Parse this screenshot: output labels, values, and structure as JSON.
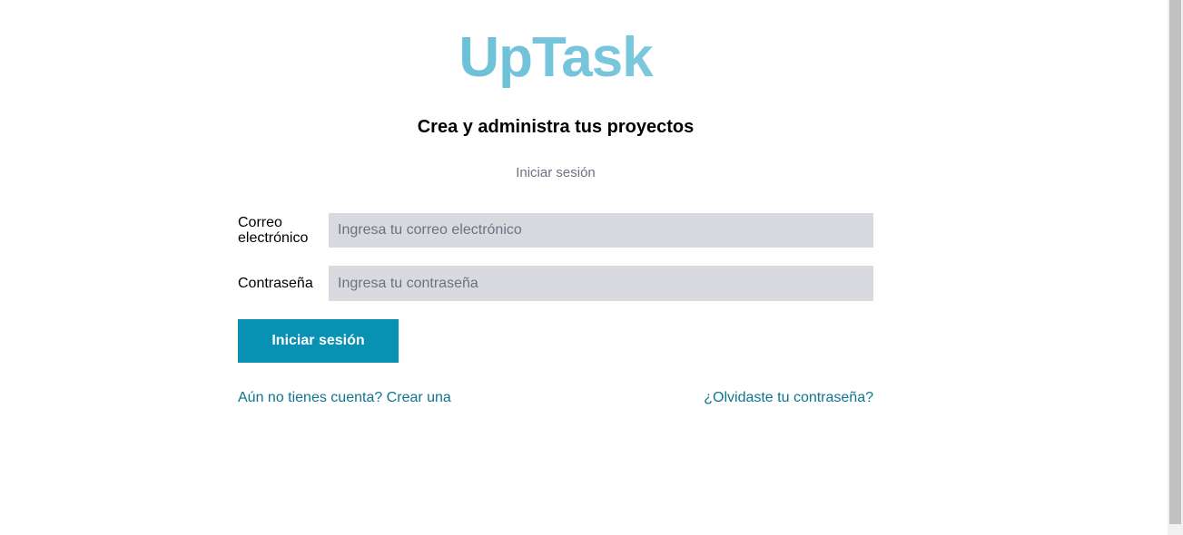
{
  "brand": {
    "logo_text": "UpTask",
    "tagline": "Crea y administra tus proyectos"
  },
  "login": {
    "subtitle": "Iniciar sesión",
    "email": {
      "label": "Correo electrónico",
      "placeholder": "Ingresa tu correo electrónico",
      "value": ""
    },
    "password": {
      "label": "Contraseña",
      "placeholder": "Ingresa tu contraseña",
      "value": ""
    },
    "submit_label": "Iniciar sesión"
  },
  "links": {
    "create_account": "Aún no tienes cuenta? Crear una",
    "forgot_password": "¿Olvidaste tu contraseña?"
  },
  "colors": {
    "accent": "#0891b2",
    "logo_start": "#5ab8d4",
    "logo_end": "#8fd0e1",
    "input_bg": "#d9dadf",
    "link": "#0e7490"
  }
}
